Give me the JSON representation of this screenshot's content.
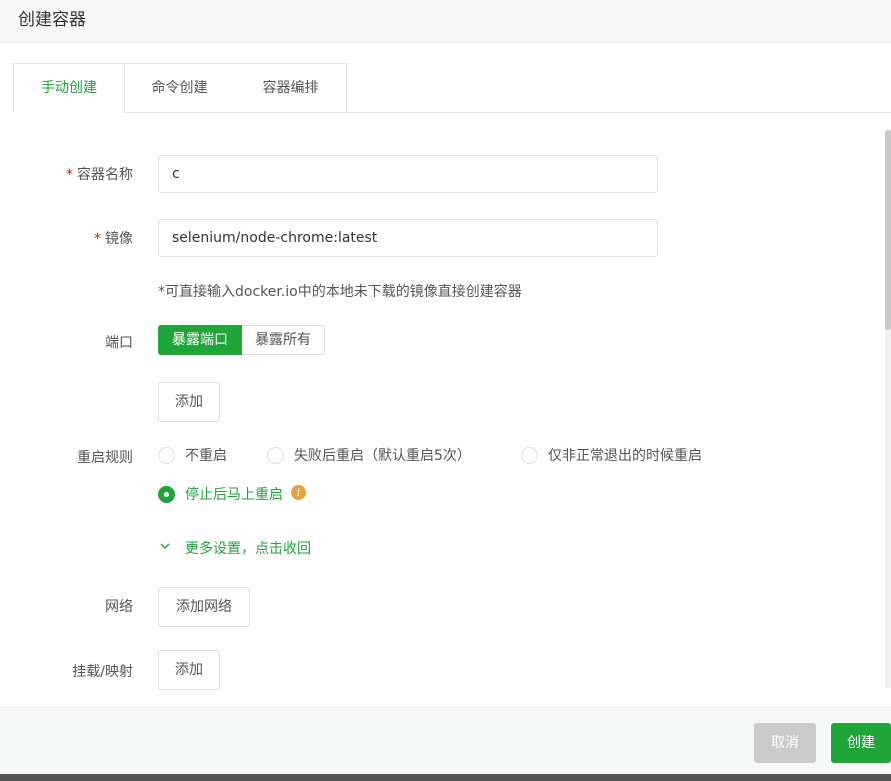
{
  "header": {
    "title": "创建容器"
  },
  "tabs": [
    {
      "label": "手动创建",
      "active": true
    },
    {
      "label": "命令创建",
      "active": false
    },
    {
      "label": "容器编排",
      "active": false
    }
  ],
  "form": {
    "name": {
      "label": "容器名称",
      "required": "*",
      "value": "c"
    },
    "image": {
      "label": "镜像",
      "required": "*",
      "value": "selenium/node-chrome:latest"
    },
    "image_hint": "*可直接输入docker.io中的本地未下载的镜像直接创建容器",
    "port": {
      "label": "端口",
      "options": [
        "暴露端口",
        "暴露所有"
      ],
      "selected": "暴露端口",
      "add_label": "添加"
    },
    "restart": {
      "label": "重启规则",
      "options": [
        {
          "label": "不重启",
          "checked": false
        },
        {
          "label": "失败后重启（默认重启5次）",
          "checked": false
        },
        {
          "label": "仅非正常退出的时候重启",
          "checked": false
        },
        {
          "label": "停止后马上重启",
          "checked": true
        }
      ],
      "info_icon": "i"
    },
    "more_settings": "更多设置，点击收回",
    "network": {
      "label": "网络",
      "add_label": "添加网络"
    },
    "mount": {
      "label": "挂载/映射",
      "add_label": "添加"
    }
  },
  "footer": {
    "cancel_label": "取消",
    "create_label": "创建"
  },
  "colors": {
    "accent": "#20a53a",
    "required": "#ef0808",
    "info": "#e6a23c",
    "disabled": "#cbcbcb"
  }
}
